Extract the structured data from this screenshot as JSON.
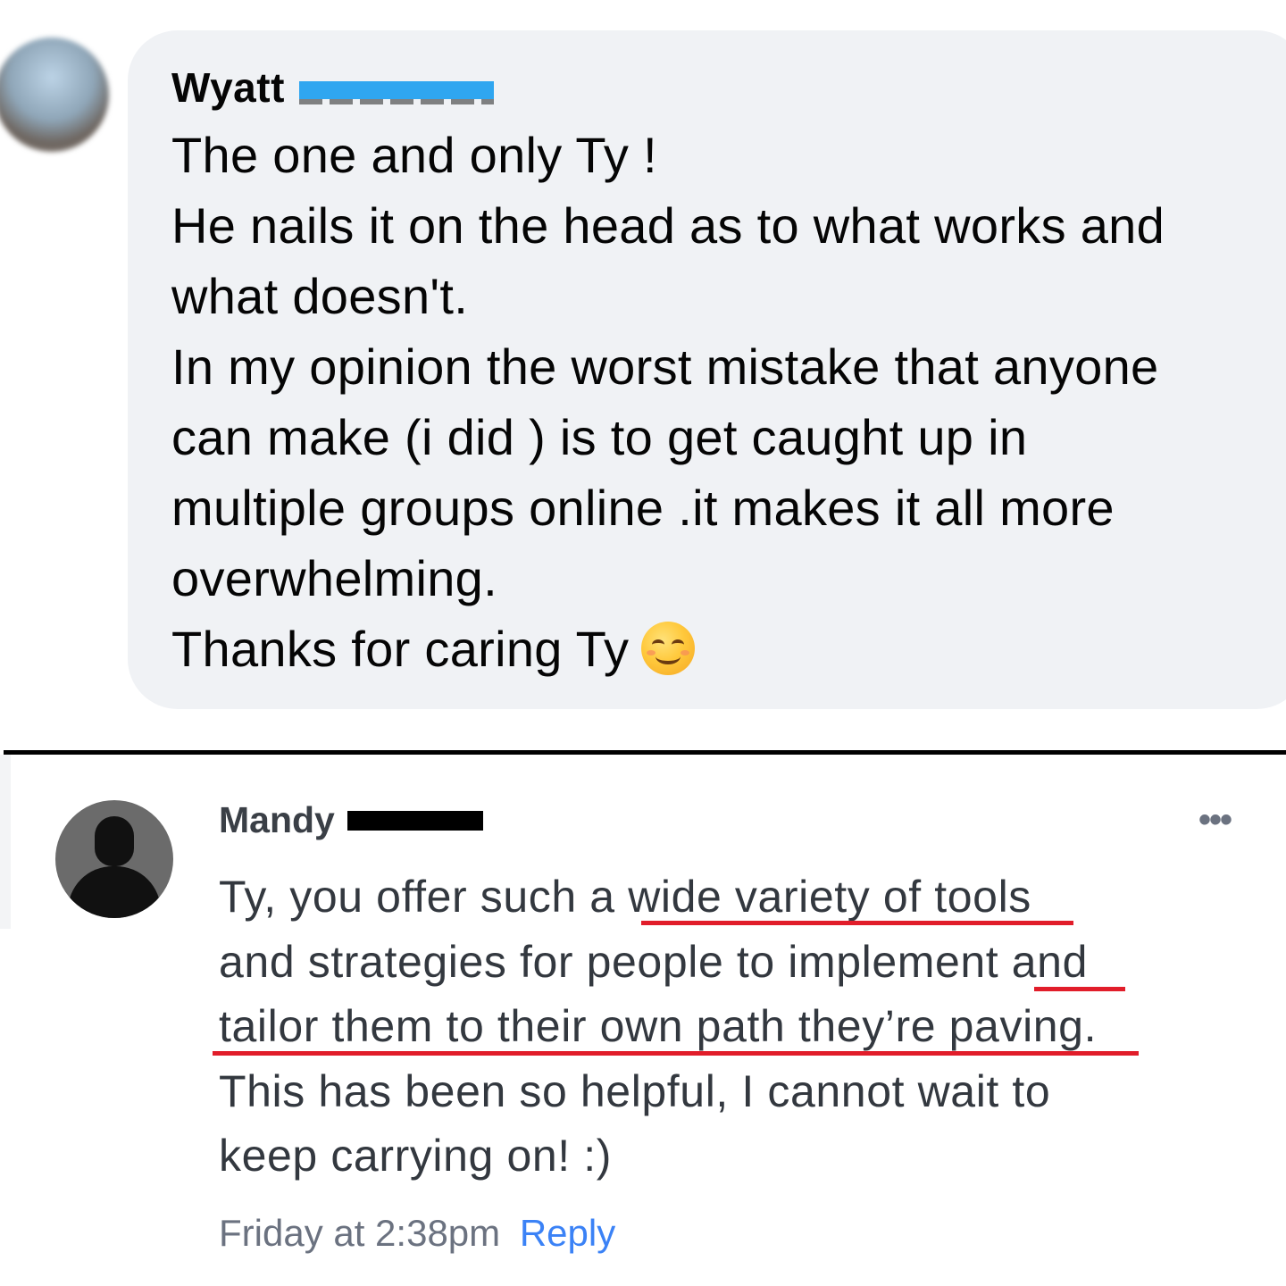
{
  "top_comment": {
    "author_first_name": "Wyatt",
    "lines": [
      "The one and only Ty !",
      "He nails it on the head as to what works and",
      "what doesn't.",
      "In my opinion the worst mistake that anyone",
      "can make (i did ) is to get caught up in",
      "multiple groups online .it makes it all more",
      "overwhelming.",
      "Thanks for caring Ty"
    ],
    "emoji": "smiling-face-icon"
  },
  "bottom_comment": {
    "author_first_name": "Mandy",
    "lines": [
      "Ty, you offer such a wide variety of tools",
      "and strategies for people to implement and",
      "tailor them to their own path they’re paving.",
      "This has been so helpful, I cannot wait to",
      "keep carrying on! :)"
    ],
    "timestamp": "Friday at 2:38pm",
    "reply_label": "Reply",
    "more_icon": "more-options-icon",
    "highlight_color": "#e11d2a"
  },
  "colors": {
    "bubble_bg": "#f0f2f5",
    "redaction_blue": "#2fa6f0",
    "redaction_black": "#000000",
    "link_blue": "#3b82f6"
  }
}
